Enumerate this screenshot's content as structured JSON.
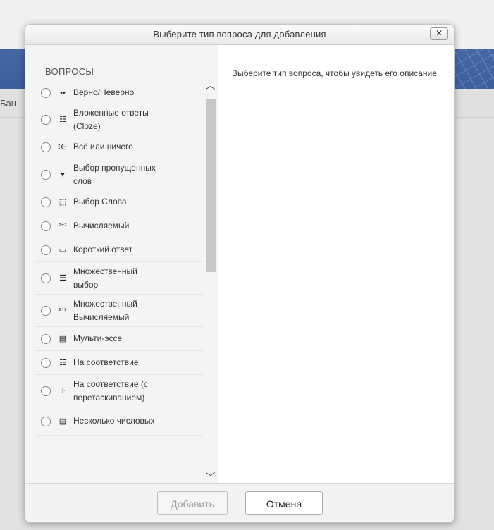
{
  "background": {
    "crumb_text": "Бан"
  },
  "dialog": {
    "title": "Выберите тип вопроса для добавления",
    "close_glyph": "✕",
    "section_label": "ВОПРОСЫ",
    "description": "Выберите тип вопроса, чтобы увидеть его описание.",
    "question_types": [
      {
        "label": "Верно/Неверно",
        "icon": "dots-icon",
        "glyph": "••"
      },
      {
        "label": "Вложенные ответы (Cloze)",
        "icon": "cloze-icon",
        "glyph": "☷"
      },
      {
        "label": "Всё или ничего",
        "icon": "all-or-nothing-icon",
        "glyph": "⁝∈"
      },
      {
        "label": "Выбор пропущенных слов",
        "icon": "dropdown-icon",
        "glyph": "▾"
      },
      {
        "label": "Выбор Слова",
        "icon": "word-select-icon",
        "glyph": "⬚"
      },
      {
        "label": "Вычисляемый",
        "icon": "calculated-icon",
        "glyph": "²⁺²"
      },
      {
        "label": "Короткий ответ",
        "icon": "short-answer-icon",
        "glyph": "▭"
      },
      {
        "label": "Множественный выбор",
        "icon": "multichoice-icon",
        "glyph": "☰"
      },
      {
        "label": "Множественный Вычисляемый",
        "icon": "calc-multi-icon",
        "glyph": "²⁺²"
      },
      {
        "label": "Мульти-эссе",
        "icon": "essay-icon",
        "glyph": "▤"
      },
      {
        "label": "На соответствие",
        "icon": "match-icon",
        "glyph": "☷"
      },
      {
        "label": "На соответствие (с перетаскиванием)",
        "icon": "drag-match-icon",
        "glyph": "⁘"
      },
      {
        "label": "Несколько числовых",
        "icon": "numerical-icon",
        "glyph": "▤"
      }
    ],
    "add_button": "Добавить",
    "cancel_button": "Отмена"
  }
}
